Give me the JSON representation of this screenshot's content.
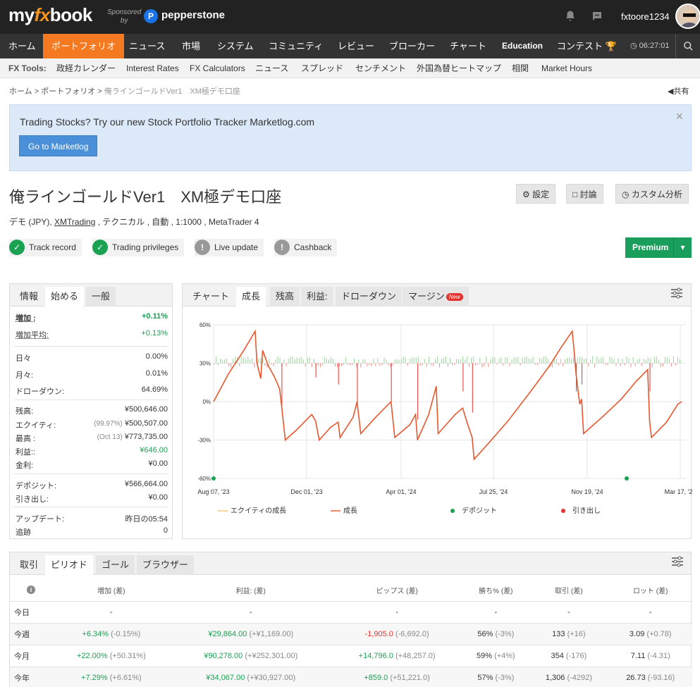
{
  "header": {
    "logo_my": "my",
    "logo_fx": "fx",
    "logo_book": "book",
    "sponsored_line1": "Sponsored",
    "sponsored_line2": "by",
    "sponsor_name": "pepperstone",
    "username": "fxtoore1234"
  },
  "nav": {
    "items": [
      "ホーム",
      "ポートフォリオ",
      "ニュース",
      "市場",
      "システム",
      "コミュニティ",
      "レビュー",
      "ブローカー",
      "チャート",
      "Education",
      "コンテスト"
    ],
    "active_index": 1,
    "time": "06:27:01"
  },
  "tools": {
    "label": "FX Tools:",
    "items": [
      "政経カレンダー",
      "Interest Rates",
      "FX Calculators",
      "ニュース",
      "スプレッド",
      "センチメント",
      "外国為替ヒートマップ",
      "相関",
      "Market Hours"
    ]
  },
  "breadcrumb": {
    "home": "ホーム",
    "sep": ">",
    "portfolio": "ポートフォリオ",
    "current": "俺ラインゴールドVer1　XM極デモ口座",
    "share": "共有"
  },
  "alert": {
    "text": "Trading Stocks? Try our new Stock Portfolio Tracker Marketlog.com",
    "button": "Go to Marketlog"
  },
  "account": {
    "title": "俺ラインゴールドVer1　XM極デモ口座",
    "info_pre": "デモ (JPY), ",
    "broker": "XMTrading",
    "info_post": " , テクニカル , 自動 , 1:1000 , MetaTrader 4",
    "buttons": [
      "設定",
      "討論",
      "カスタム分析"
    ],
    "badges": [
      {
        "label": "Track record",
        "status": "ok"
      },
      {
        "label": "Trading privileges",
        "status": "ok"
      },
      {
        "label": "Live update",
        "status": "warn"
      },
      {
        "label": "Cashback",
        "status": "warn"
      }
    ],
    "premium": "Premium"
  },
  "stats": {
    "tabs": [
      "情報",
      "始める",
      "一般"
    ],
    "rows": [
      {
        "label": "増加 :",
        "value": "+0.11%",
        "color": "green",
        "bold": true
      },
      {
        "label": "増加平均:",
        "value": "+0.13%",
        "color": "green"
      },
      {
        "label": "日々",
        "value": "0.00%"
      },
      {
        "label": "月々:",
        "value": "0.01%"
      },
      {
        "label": "ドローダウン:",
        "value": "64.69%"
      },
      {
        "label": "残高:",
        "value": "¥500,646.00"
      },
      {
        "label": "エクイティ:",
        "sub": "(99.97%)",
        "value": "¥500,507.00"
      },
      {
        "label": "最高 :",
        "sub": "(Oct 13)",
        "value": "¥773,735.00"
      },
      {
        "label": "利益::",
        "value": "¥646.00",
        "color": "green"
      },
      {
        "label": "金利:",
        "value": "¥0.00"
      },
      {
        "label": "デポジット:",
        "value": "¥566,664.00"
      },
      {
        "label": "引き出し:",
        "value": "¥0.00"
      },
      {
        "label": "アップデート:",
        "value": "昨日の05:54"
      },
      {
        "label": "追跡",
        "value": "0"
      }
    ]
  },
  "chart_tabs": {
    "items": [
      "チャート",
      "成長",
      "残高",
      "利益:",
      "ドローダウン",
      "マージン"
    ],
    "new_badge": "New"
  },
  "chart_data": {
    "type": "line",
    "x_labels": [
      "Aug 07, '23",
      "Dec 01, '23",
      "Apr 01, '24",
      "Jul 25, '24",
      "Nov 19, '24",
      "Mar 17, '25"
    ],
    "y_ticks": [
      "60%",
      "30%",
      "0%",
      "-30%",
      "-60%"
    ],
    "ylim": [
      -60,
      60
    ],
    "grid": true,
    "legend_position": "bottom",
    "series": [
      {
        "name": "エクイティの成長",
        "color": "#f5c26b"
      },
      {
        "name": "成長",
        "color": "#e8572c",
        "points": [
          [
            0,
            0
          ],
          [
            0.04,
            22
          ],
          [
            0.08,
            40
          ],
          [
            0.11,
            55
          ],
          [
            0.115,
            30
          ],
          [
            0.125,
            18
          ],
          [
            0.13,
            40
          ],
          [
            0.145,
            28
          ],
          [
            0.16,
            20
          ],
          [
            0.175,
            10
          ],
          [
            0.18,
            -3
          ],
          [
            0.19,
            -30
          ],
          [
            0.22,
            -22
          ],
          [
            0.26,
            -10
          ],
          [
            0.27,
            -15
          ],
          [
            0.28,
            -30
          ],
          [
            0.31,
            -20
          ],
          [
            0.33,
            -16
          ],
          [
            0.335,
            -28
          ],
          [
            0.37,
            -12
          ],
          [
            0.38,
            0
          ],
          [
            0.39,
            -25
          ],
          [
            0.43,
            -12
          ],
          [
            0.47,
            0
          ],
          [
            0.48,
            -28
          ],
          [
            0.52,
            -18
          ],
          [
            0.535,
            -10
          ],
          [
            0.54,
            -30
          ],
          [
            0.57,
            -10
          ],
          [
            0.59,
            12
          ],
          [
            0.595,
            -25
          ],
          [
            0.64,
            -10
          ],
          [
            0.66,
            -5
          ],
          [
            0.67,
            -15
          ],
          [
            0.685,
            -28
          ],
          [
            0.69,
            -45
          ],
          [
            0.73,
            -32
          ],
          [
            0.78,
            -15
          ],
          [
            0.84,
            8
          ],
          [
            0.89,
            28
          ],
          [
            0.92,
            42
          ],
          [
            0.95,
            55
          ],
          [
            0.955,
            40
          ],
          [
            0.96,
            22
          ],
          [
            0.965,
            10
          ],
          [
            0.97,
            -2
          ],
          [
            0.975,
            2
          ],
          [
            0.98,
            -25
          ],
          [
            1.03,
            -12
          ],
          [
            1.08,
            2
          ],
          [
            1.12,
            16
          ],
          [
            1.15,
            25
          ],
          [
            1.155,
            -15
          ],
          [
            1.16,
            -28
          ],
          [
            1.2,
            -16
          ],
          [
            1.23,
            -2
          ],
          [
            1.24,
            0
          ]
        ]
      },
      {
        "name": "デポジット",
        "color": "#1aa152"
      },
      {
        "name": "引き出し",
        "color": "#e5322d"
      }
    ]
  },
  "bottom": {
    "tabs": [
      "取引",
      "ピリオド",
      "ゴール",
      "ブラウザー"
    ],
    "columns": [
      "増加 (差)",
      "利益: (差)",
      "ピップス (差)",
      "勝ち% (差)",
      "取引 (差)",
      "ロット (差)"
    ],
    "rows": [
      {
        "label": "今日",
        "cells": [
          {
            "v": "-"
          },
          {
            "v": "-"
          },
          {
            "v": "-"
          },
          {
            "v": "-"
          },
          {
            "v": "-"
          },
          {
            "v": "-"
          }
        ]
      },
      {
        "label": "今週",
        "cells": [
          {
            "v": "+6.34%",
            "d": "(-0.15%)",
            "c": "green"
          },
          {
            "v": "¥29,864.00",
            "d": "(+¥1,169.00)",
            "c": "green"
          },
          {
            "v": "-1,905.0",
            "d": "(-6,692.0)",
            "c": "red"
          },
          {
            "v": "56%",
            "d": "(-3%)"
          },
          {
            "v": "133",
            "d": "(+16)"
          },
          {
            "v": "3.09",
            "d": "(+0.78)"
          }
        ]
      },
      {
        "label": "今月",
        "cells": [
          {
            "v": "+22.00%",
            "d": "(+50.31%)",
            "c": "green"
          },
          {
            "v": "¥90,278.00",
            "d": "(+¥252,301.00)",
            "c": "green"
          },
          {
            "v": "+14,796.0",
            "d": "(+48,257.0)",
            "c": "green"
          },
          {
            "v": "59%",
            "d": "(+4%)"
          },
          {
            "v": "354",
            "d": "(-176)"
          },
          {
            "v": "7.11",
            "d": "(-4.31)"
          }
        ]
      },
      {
        "label": "今年",
        "cells": [
          {
            "v": "+7.29%",
            "d": "(+6.61%)",
            "c": "green"
          },
          {
            "v": "¥34,067.00",
            "d": "(+¥30,927.00)",
            "c": "green"
          },
          {
            "v": "+859.0",
            "d": "(+51,221.0)",
            "c": "green"
          },
          {
            "v": "57%",
            "d": "(-3%)"
          },
          {
            "v": "1,306",
            "d": "(-4292)"
          },
          {
            "v": "26.73",
            "d": "(-93.16)"
          }
        ]
      }
    ]
  }
}
